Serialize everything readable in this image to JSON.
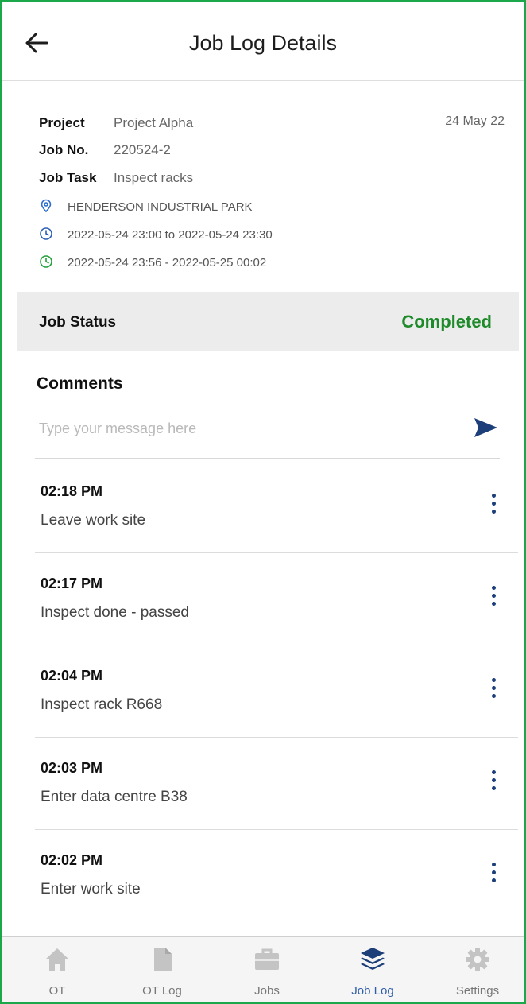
{
  "header": {
    "title": "Job Log Details"
  },
  "job": {
    "project_label": "Project",
    "project_value": "Project Alpha",
    "date": "24 May 22",
    "job_no_label": "Job No.",
    "job_no_value": "220524-2",
    "task_label": "Job Task",
    "task_value": "Inspect racks",
    "location": "HENDERSON INDUSTRIAL PARK",
    "scheduled": "2022-05-24 23:00 to 2022-05-24 23:30",
    "actual": "2022-05-24 23:56 - 2022-05-25 00:02"
  },
  "status": {
    "label": "Job Status",
    "value": "Completed"
  },
  "comments": {
    "title": "Comments",
    "placeholder": "Type your message here",
    "items": [
      {
        "time": "02:18 PM",
        "text": "Leave work site"
      },
      {
        "time": "02:17 PM",
        "text": "Inspect done - passed"
      },
      {
        "time": "02:04 PM",
        "text": "Inspect rack R668"
      },
      {
        "time": "02:03 PM",
        "text": "Enter data centre B38"
      },
      {
        "time": "02:02 PM",
        "text": "Enter work site"
      }
    ]
  },
  "nav": {
    "items": [
      {
        "label": "OT",
        "icon": "home-icon"
      },
      {
        "label": "OT Log",
        "icon": "document-icon"
      },
      {
        "label": "Jobs",
        "icon": "briefcase-icon"
      },
      {
        "label": "Job Log",
        "icon": "layers-icon"
      },
      {
        "label": "Settings",
        "icon": "gear-icon"
      }
    ],
    "active": "Job Log"
  },
  "colors": {
    "accent": "#1c3f7a",
    "active_nav": "#2f5da8",
    "status_completed": "#1e8a2a",
    "frame_border": "#1aa84a",
    "location_icon": "#2c6fd0",
    "actual_clock_icon": "#22a03a"
  }
}
